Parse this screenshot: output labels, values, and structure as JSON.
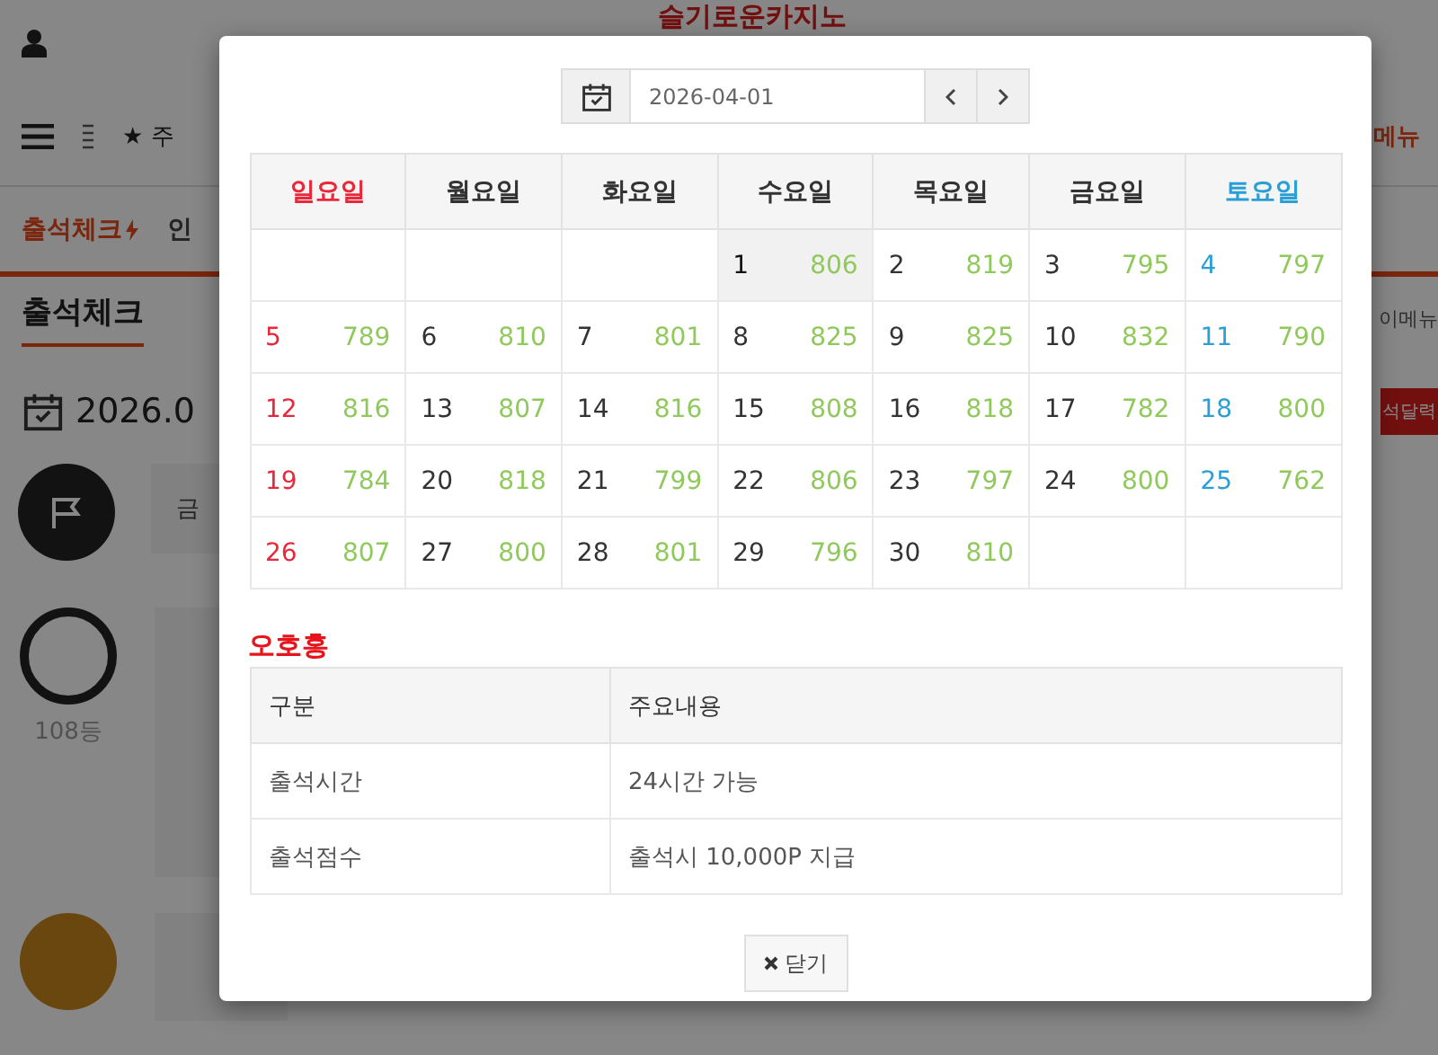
{
  "background": {
    "logo": "슬기로운카지노",
    "nav_text": "★ 주",
    "right_menu": "메뉴",
    "tabs": [
      {
        "label": "출석체크",
        "selected": true
      },
      {
        "label": "인",
        "selected": false
      }
    ],
    "heading": "출석체크",
    "side_link": "이메뉴",
    "date": "2026.0",
    "calendar_button": "석달력",
    "feed": [
      {
        "kind": "flag",
        "text": "금"
      },
      {
        "kind": "avatar",
        "rank": "108등"
      },
      {
        "kind": "avatar"
      }
    ]
  },
  "modal": {
    "date_value": "2026-04-01",
    "weekdays": [
      {
        "label": "일요일",
        "kind": "sunday"
      },
      {
        "label": "월요일",
        "kind": "weekday"
      },
      {
        "label": "화요일",
        "kind": "weekday"
      },
      {
        "label": "수요일",
        "kind": "weekday"
      },
      {
        "label": "목요일",
        "kind": "weekday"
      },
      {
        "label": "금요일",
        "kind": "weekday"
      },
      {
        "label": "토요일",
        "kind": "saturday"
      }
    ],
    "weeks": [
      [
        {
          "kind": "empty"
        },
        {
          "kind": "empty"
        },
        {
          "kind": "empty"
        },
        {
          "kind": "day",
          "day": "1",
          "count": "806",
          "selected": true
        },
        {
          "kind": "day",
          "day": "2",
          "count": "819",
          "selected": false
        },
        {
          "kind": "day",
          "day": "3",
          "count": "795",
          "selected": false
        },
        {
          "kind": "day",
          "day": "4",
          "count": "797",
          "selected": false
        }
      ],
      [
        {
          "kind": "day",
          "day": "5",
          "count": "789",
          "selected": false
        },
        {
          "kind": "day",
          "day": "6",
          "count": "810",
          "selected": false
        },
        {
          "kind": "day",
          "day": "7",
          "count": "801",
          "selected": false
        },
        {
          "kind": "day",
          "day": "8",
          "count": "825",
          "selected": false
        },
        {
          "kind": "day",
          "day": "9",
          "count": "825",
          "selected": false
        },
        {
          "kind": "day",
          "day": "10",
          "count": "832",
          "selected": false
        },
        {
          "kind": "day",
          "day": "11",
          "count": "790",
          "selected": false
        }
      ],
      [
        {
          "kind": "day",
          "day": "12",
          "count": "816",
          "selected": false
        },
        {
          "kind": "day",
          "day": "13",
          "count": "807",
          "selected": false
        },
        {
          "kind": "day",
          "day": "14",
          "count": "816",
          "selected": false
        },
        {
          "kind": "day",
          "day": "15",
          "count": "808",
          "selected": false
        },
        {
          "kind": "day",
          "day": "16",
          "count": "818",
          "selected": false
        },
        {
          "kind": "day",
          "day": "17",
          "count": "782",
          "selected": false
        },
        {
          "kind": "day",
          "day": "18",
          "count": "800",
          "selected": false
        }
      ],
      [
        {
          "kind": "day",
          "day": "19",
          "count": "784",
          "selected": false
        },
        {
          "kind": "day",
          "day": "20",
          "count": "818",
          "selected": false
        },
        {
          "kind": "day",
          "day": "21",
          "count": "799",
          "selected": false
        },
        {
          "kind": "day",
          "day": "22",
          "count": "806",
          "selected": false
        },
        {
          "kind": "day",
          "day": "23",
          "count": "797",
          "selected": false
        },
        {
          "kind": "day",
          "day": "24",
          "count": "800",
          "selected": false
        },
        {
          "kind": "day",
          "day": "25",
          "count": "762",
          "selected": false
        }
      ],
      [
        {
          "kind": "day",
          "day": "26",
          "count": "807",
          "selected": false
        },
        {
          "kind": "day",
          "day": "27",
          "count": "800",
          "selected": false
        },
        {
          "kind": "day",
          "day": "28",
          "count": "801",
          "selected": false
        },
        {
          "kind": "day",
          "day": "29",
          "count": "796",
          "selected": false
        },
        {
          "kind": "day",
          "day": "30",
          "count": "810",
          "selected": false
        },
        {
          "kind": "empty"
        },
        {
          "kind": "empty"
        }
      ]
    ],
    "section_title": "오호홍",
    "info_columns": [
      "구분",
      "주요내용"
    ],
    "info_rows": [
      [
        "출석시간",
        "24시간 가능"
      ],
      [
        "출석점수",
        "출석시 10,000P 지급"
      ]
    ],
    "close_button": "닫기"
  }
}
